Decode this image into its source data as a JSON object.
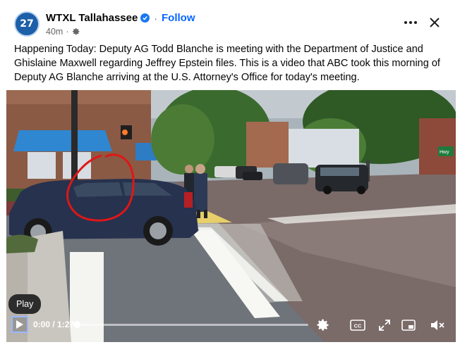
{
  "post": {
    "page_name": "WTXL Tallahassee",
    "avatar_text": "27",
    "follow_label": "Follow",
    "separator": "·",
    "time_ago": "40m",
    "meta_separator": "·",
    "text": "Happening Today: Deputy AG Todd Blanche is meeting with the Department of Justice and Ghislaine Maxwell regarding Jeffrey Epstein files. This is a video that ABC took this morning of Deputy AG Blanche arriving at the U.S. Attorney's Office for today's meeting."
  },
  "video": {
    "tooltip": "Play",
    "time_display": "0:00 / 1:27",
    "progress": 0,
    "sign_text": "Hwy",
    "cc_label": "CC"
  },
  "icons": {
    "verified": "verified-badge-icon",
    "privacy": "gear-icon",
    "more": "more-horizontal-icon",
    "close": "close-icon",
    "play": "play-icon",
    "settings": "settings-gear-icon",
    "captions": "closed-captions-icon",
    "fullscreen": "fullscreen-icon",
    "pip": "picture-in-picture-icon",
    "mute": "volume-muted-icon"
  },
  "colors": {
    "accent": "#0866ff",
    "verified": "#1877f2",
    "annotation": "#e01616",
    "text": "#050505",
    "secondary": "#65676b"
  }
}
